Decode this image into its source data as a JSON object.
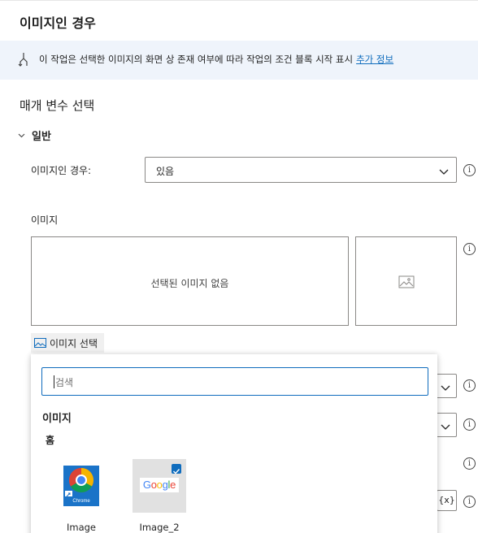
{
  "header": {
    "title": "이미지인 경우"
  },
  "info_bar": {
    "text": "이 작업은 선택한 이미지의 화면 상 존재 여부에 따라 작업의 조건 블록 시작 표시",
    "link": "추가 정보",
    "icon": "flow-branch-icon"
  },
  "params": {
    "title": "매개 변수 선택",
    "group": "일반",
    "if_image_label": "이미지인 경우:",
    "if_image_value": "있음",
    "image_label": "이미지",
    "no_image_text": "선택된 이미지 없음",
    "select_image_button": "이미지 선택",
    "var_button": "{x}"
  },
  "popup": {
    "search_placeholder": "검색",
    "heading": "이미지",
    "subheading": "홈",
    "items": [
      {
        "name": "Image",
        "icon": "chrome-shortcut-icon",
        "selected": false
      },
      {
        "name": "Image_2",
        "icon": "google-logo-icon",
        "selected": true
      }
    ]
  },
  "colors": {
    "accent": "#0f6cbd",
    "info_bg": "#eff4fb"
  }
}
